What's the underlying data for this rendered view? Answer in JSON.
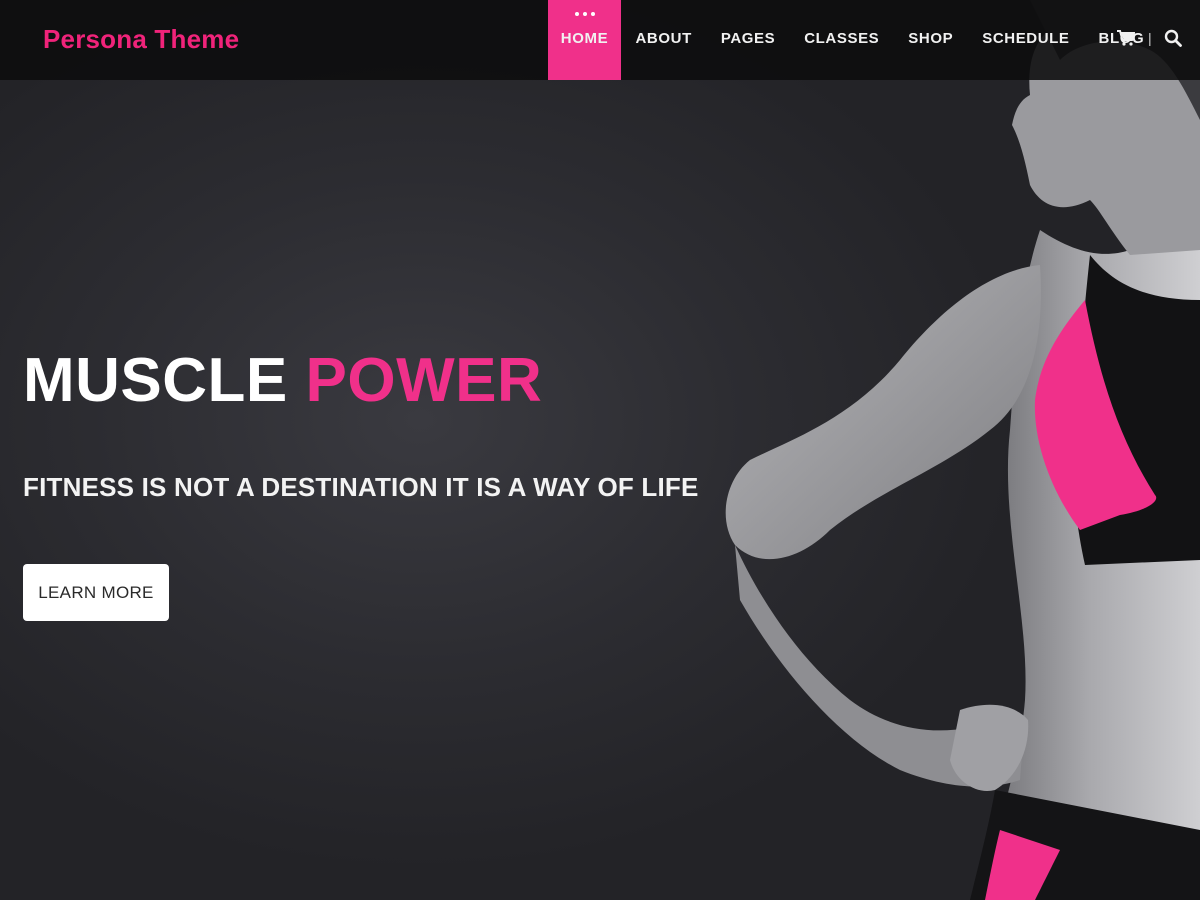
{
  "site": {
    "logo": "Persona Theme"
  },
  "nav": {
    "items": [
      {
        "label": "HOME",
        "active": true
      },
      {
        "label": "ABOUT"
      },
      {
        "label": "PAGES"
      },
      {
        "label": "CLASSES"
      },
      {
        "label": "SHOP"
      },
      {
        "label": "SCHEDULE"
      },
      {
        "label": "BLOG"
      }
    ],
    "separator": "|",
    "icons": [
      "cart-icon",
      "search-icon"
    ]
  },
  "hero": {
    "title_word_1": "MUSCLE",
    "title_word_2": "POWER",
    "subtitle": "FITNESS IS NOT A DESTINATION IT IS A WAY OF LIFE",
    "button_label": "LEARN MORE"
  },
  "colors": {
    "accent": "#f0308a",
    "logo": "#f0237a",
    "background": "#2b2b30",
    "nav_bg": "#0c0c0e"
  }
}
